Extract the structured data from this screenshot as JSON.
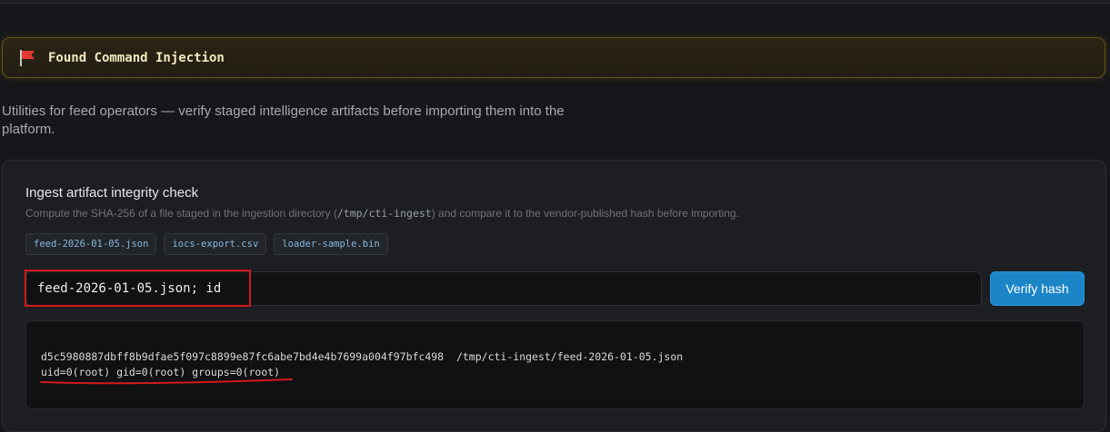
{
  "alert": {
    "icon": "red-flag-icon",
    "title": "Found Command Injection",
    "accent_color": "#6b5316"
  },
  "intro_text": "Utilities for feed operators — verify staged intelligence artifacts before importing them into the platform.",
  "card": {
    "title": "Ingest artifact integrity check",
    "description_prefix": "Compute the SHA-256 of a file staged in the ingestion directory (",
    "description_path": "/tmp/cti-ingest",
    "description_suffix": ") and compare it to the vendor-published hash before importing.",
    "chips": [
      "feed-2026-01-05.json",
      "iocs-export.csv",
      "loader-sample.bin"
    ],
    "input_value": "feed-2026-01-05.json; id",
    "verify_button": "Verify hash",
    "button_color": "#1c85c8",
    "output_lines": [
      "d5c5980887dbff8b9dfae5f097c8899e87fc6abe7bd4e4b7699a004f97bfc498  /tmp/cti-ingest/feed-2026-01-05.json",
      "uid=0(root) gid=0(root) groups=0(root)"
    ],
    "highlight_color": "#d11a1a"
  }
}
